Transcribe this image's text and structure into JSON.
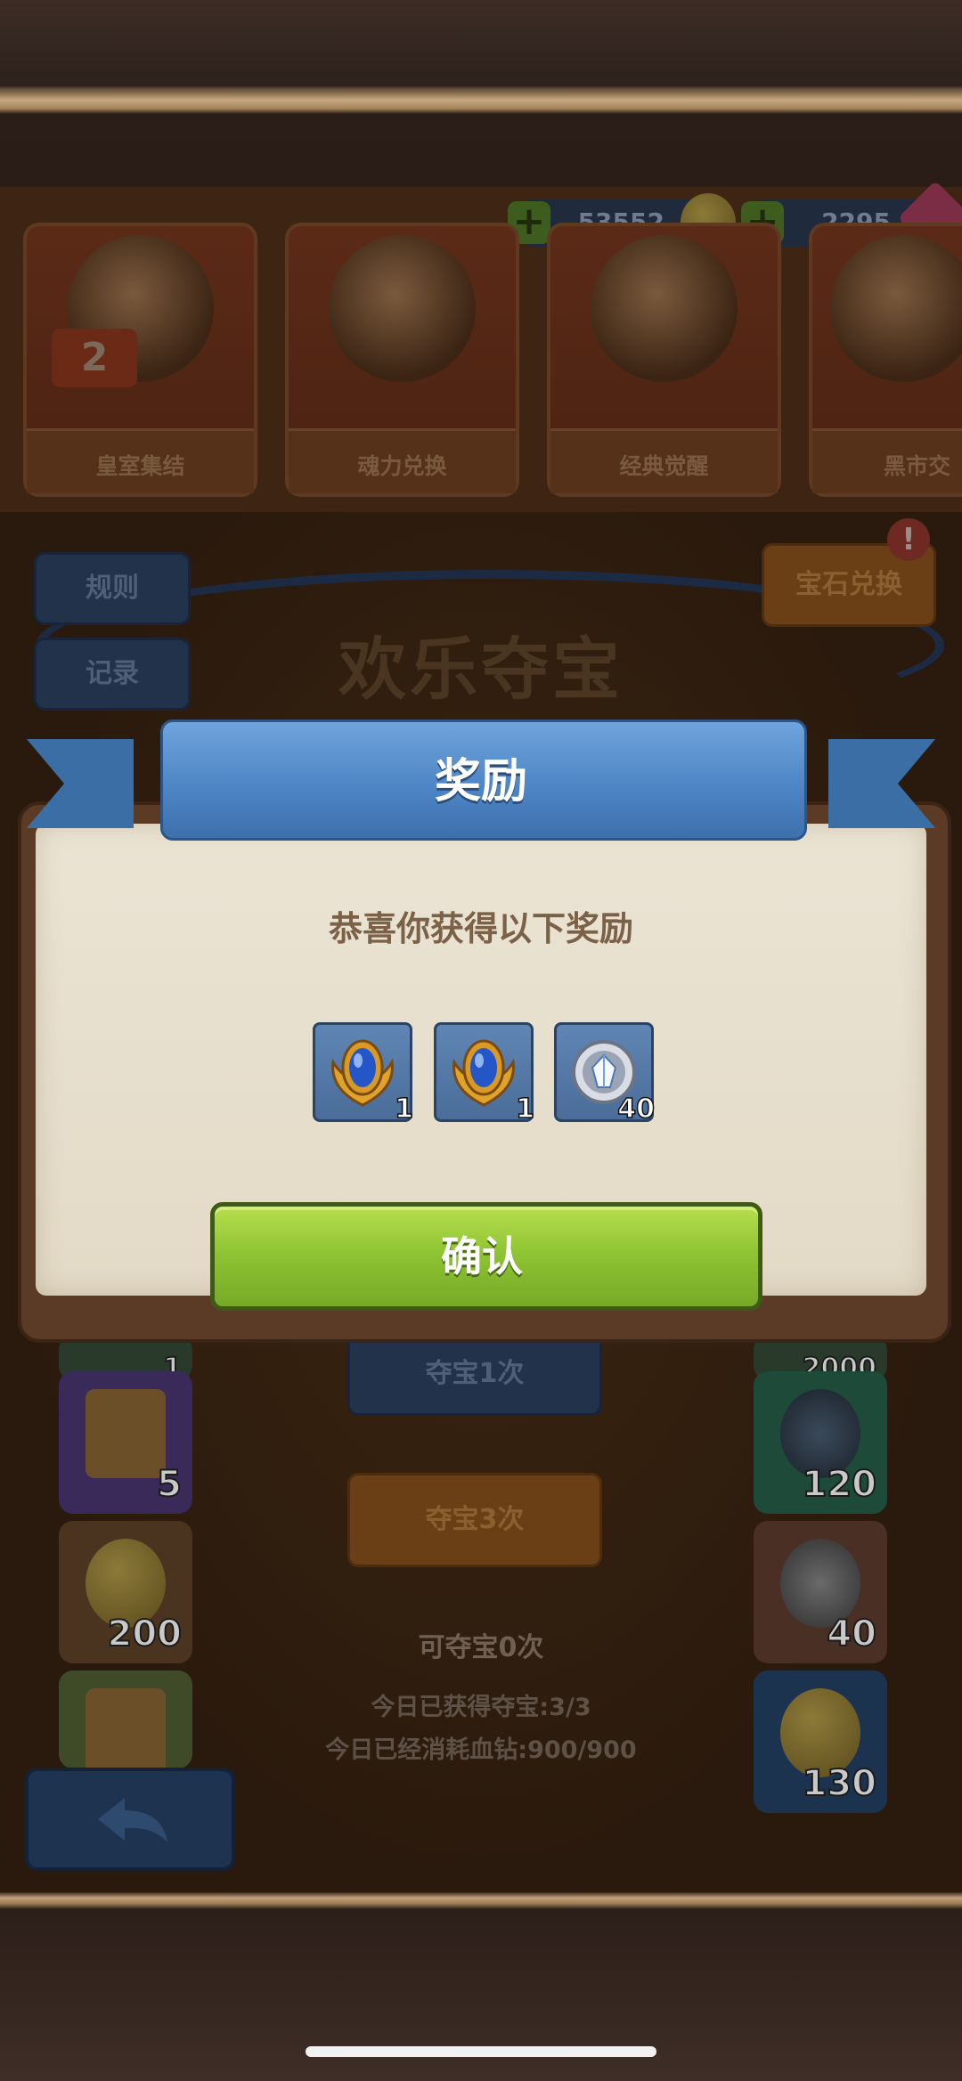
{
  "currency": {
    "gold": "53552",
    "gems": "2295",
    "plus": "+"
  },
  "shop_tabs": [
    {
      "label": "皇室集结",
      "badge": "2"
    },
    {
      "label": "魂力兑换"
    },
    {
      "label": "经典觉醒"
    },
    {
      "label": "黑市交"
    }
  ],
  "event": {
    "title": "欢乐夺宝",
    "rules_button": "规则",
    "records_button": "记录",
    "gem_exchange_button": "宝石兑换",
    "alert_mark": "!",
    "draw_once": "夺宝1次",
    "draw_three": "夺宝3次",
    "draws_left": "可夺宝0次",
    "today_obtained": "今日已获得夺宝:3/3",
    "today_consumed": "今日已经消耗血钻:900/900"
  },
  "left_rewards": [
    {
      "amount": "1",
      "type": "top-tile"
    },
    {
      "amount": "5",
      "type": "card-pack"
    },
    {
      "amount": "200",
      "type": "gold-coin"
    },
    {
      "amount": "",
      "type": "card-pack"
    }
  ],
  "right_rewards": [
    {
      "amount": "2000",
      "type": "top-tile"
    },
    {
      "amount": "120",
      "type": "soul-crystal-dark"
    },
    {
      "amount": "40",
      "type": "soul-crystal"
    },
    {
      "amount": "130",
      "type": "gold-coin"
    }
  ],
  "modal": {
    "title": "奖励",
    "message": "恭喜你获得以下奖励",
    "items": [
      {
        "icon": "blue-gem-wings-icon",
        "quantity": "1"
      },
      {
        "icon": "blue-gem-wings-icon",
        "quantity": "1"
      },
      {
        "icon": "soul-crystal-icon",
        "quantity": "40"
      }
    ],
    "confirm_label": "确认"
  },
  "colors": {
    "ribbon_blue": "#4e86c6",
    "confirm_green": "#8cc232",
    "parchment": "#e9e2d2"
  }
}
